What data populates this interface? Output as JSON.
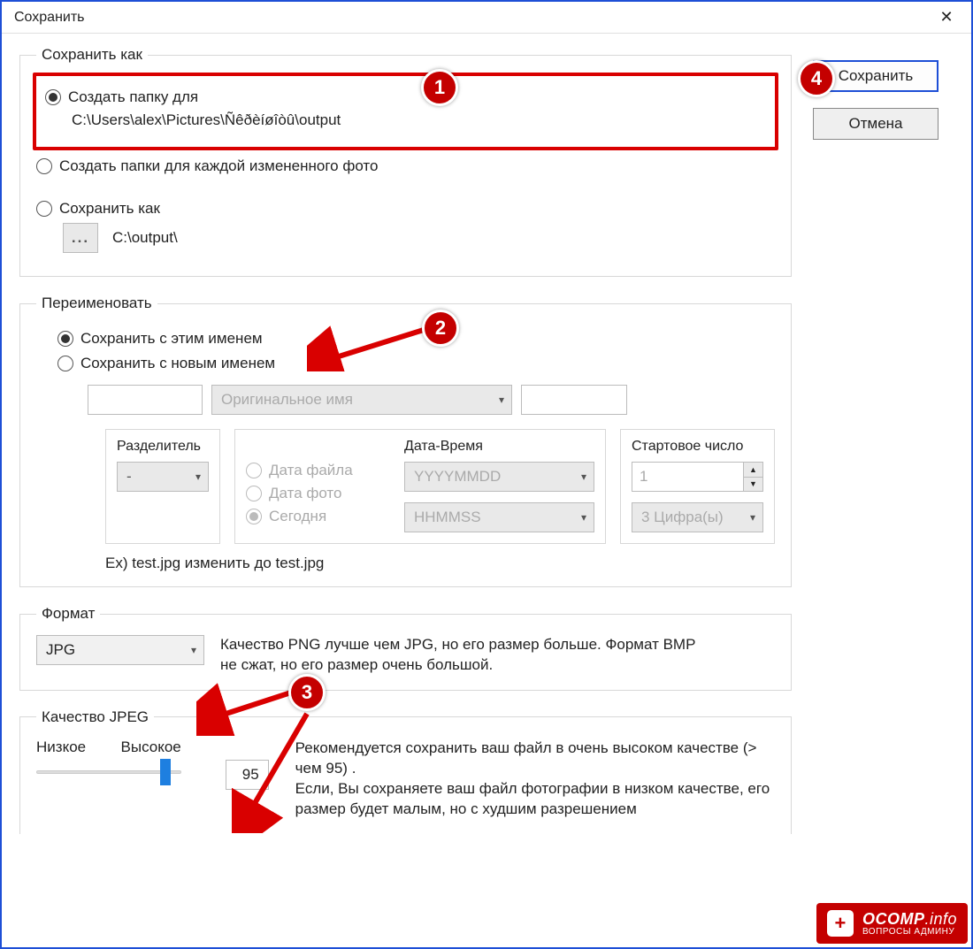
{
  "window": {
    "title": "Сохранить"
  },
  "buttons": {
    "save": "Сохранить",
    "cancel": "Отмена"
  },
  "save_as": {
    "legend": "Сохранить как",
    "opt_create_folder": "Создать папку для",
    "create_folder_path": "C:\\Users\\alex\\Pictures\\Ñêðèíøîòû\\output",
    "opt_create_each": "Создать папки для каждой измененного фото",
    "opt_save_as": "Сохранить как",
    "browse_ellipsis": "...",
    "save_as_path": "C:\\output\\"
  },
  "rename": {
    "legend": "Переименовать",
    "opt_keep_name": "Сохранить с этим именем",
    "opt_new_name": "Сохранить с новым именем",
    "name_pattern_placeholder": "Оригинальное имя",
    "separator": {
      "title": "Разделитель",
      "value": "-"
    },
    "datetime": {
      "title": "Дата-Время",
      "radio_date_file": "Дата файла",
      "radio_date_photo": "Дата фото",
      "radio_today": "Сегодня",
      "date_fmt": "YYYYMMDD",
      "time_fmt": "HHMMSS"
    },
    "start_number": {
      "title": "Стартовое число",
      "value": "1",
      "digits": "3 Цифра(ы)"
    },
    "example": "Ex) test.jpg изменить до test.jpg"
  },
  "format": {
    "legend": "Формат",
    "value": "JPG",
    "note": "Качество PNG лучше чем JPG, но его размер  больше. Формат BMP не сжат, но его размер  очень большой."
  },
  "jpeg_quality": {
    "legend": "Качество JPEG",
    "low": "Низкое",
    "high": "Высокое",
    "value": "95",
    "note": "Рекомендуется сохранить ваш файл в  очень высоком качестве (> чем 95) .\nЕсли, Вы сохраняете ваш файл фотографии в низком качестве, его размер будет малым, но с худшим  разрешением"
  },
  "watermark": {
    "brand_main": "OCOMP",
    "brand_suffix": ".info",
    "tagline": "ВОПРОСЫ АДМИНУ"
  },
  "annotations": {
    "1": "1",
    "2": "2",
    "3": "3",
    "4": "4"
  }
}
